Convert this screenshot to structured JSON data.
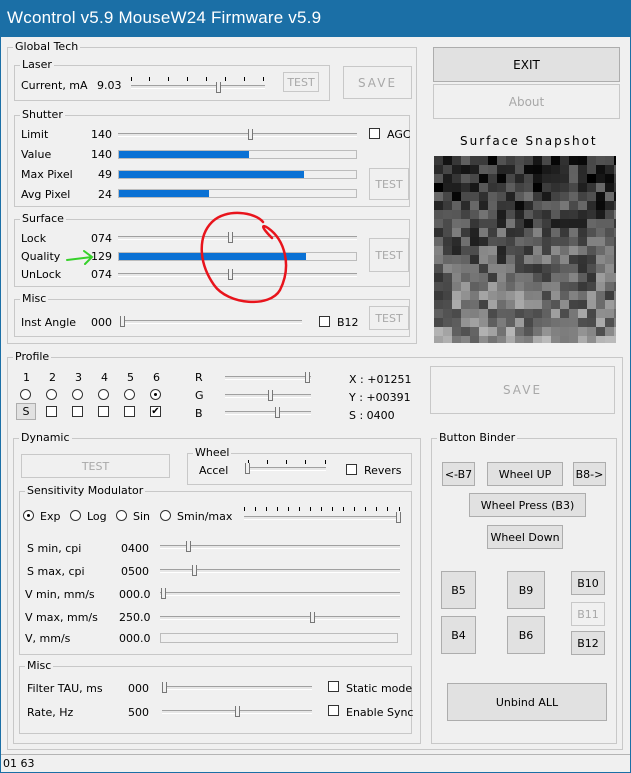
{
  "title": "Wcontrol v5.9  MouseW24  Firmware v5.9",
  "global_tech": {
    "title": "Global Tech",
    "laser": {
      "title": "Laser",
      "label": "Current, mA",
      "value": "9.03",
      "test": "TEST"
    },
    "save": "SAVE",
    "shutter": {
      "title": "Shutter",
      "rows": [
        {
          "label": "Limit",
          "value": "140"
        },
        {
          "label": "Value",
          "value": "140",
          "level": 0.55
        },
        {
          "label": "Max Pixel",
          "value": "49",
          "level": 0.78
        },
        {
          "label": "Avg Pixel",
          "value": "24",
          "level": 0.38
        }
      ],
      "agc": "AGC",
      "test": "TEST"
    },
    "surface": {
      "title": "Surface",
      "rows": [
        {
          "label": "Lock",
          "value": "074"
        },
        {
          "label": "Quality",
          "value": "129",
          "level": 0.79
        },
        {
          "label": "UnLock",
          "value": "074"
        }
      ],
      "test": "TEST"
    },
    "misc": {
      "title": "Misc",
      "label": "Inst Angle",
      "value": "000",
      "b12": "B12",
      "test": "TEST"
    }
  },
  "exit": "EXIT",
  "about": "About",
  "snapshot_title": "Surface Snapshot",
  "profile": {
    "title": "Profile",
    "numbers": [
      "1",
      "2",
      "3",
      "4",
      "5",
      "6"
    ],
    "s_button": "S",
    "rgb": {
      "r": "R",
      "g": "G",
      "b": "B"
    },
    "coords": {
      "x": "X : +01251",
      "y": "Y : +00391",
      "s": "S :  0400"
    },
    "save": "SAVE"
  },
  "dynamic": {
    "title": "Dynamic",
    "test": "TEST",
    "wheel": {
      "title": "Wheel",
      "accel": "Accel",
      "revers": "Revers"
    },
    "sens": {
      "title": "Sensitivity Modulator",
      "modes": [
        "Exp",
        "Log",
        "Sin",
        "Smin/max"
      ],
      "rows": [
        {
          "label": "S min, cpi",
          "value": "0400"
        },
        {
          "label": "S max, cpi",
          "value": "0500"
        },
        {
          "label": "V min, mm/s",
          "value": "000.0"
        },
        {
          "label": "V max, mm/s",
          "value": "250.0"
        },
        {
          "label": "V, mm/s",
          "value": "000.0"
        }
      ]
    },
    "misc": {
      "title": "Misc",
      "rows": [
        {
          "label": "Filter TAU, ms",
          "value": "000",
          "check": "Static mode"
        },
        {
          "label": "Rate, Hz",
          "value": "500",
          "check": "Enable Sync"
        }
      ]
    }
  },
  "binder": {
    "title": "Button Binder",
    "b7": "<-B7",
    "wheel_up": "Wheel UP",
    "b8": "B8->",
    "wheel_press": "Wheel Press (B3)",
    "wheel_down": "Wheel Down",
    "b5": "B5",
    "b9": "B9",
    "b10": "B10",
    "b11": "B11",
    "b4": "B4",
    "b6": "B6",
    "b12": "B12",
    "unbind": "Unbind ALL"
  },
  "status": "01 63",
  "colors": {
    "title_bar": "#1b6fa6",
    "progress": "#0a71d4",
    "annotation_red": "#e8141c",
    "annotation_green": "#36d12a"
  }
}
